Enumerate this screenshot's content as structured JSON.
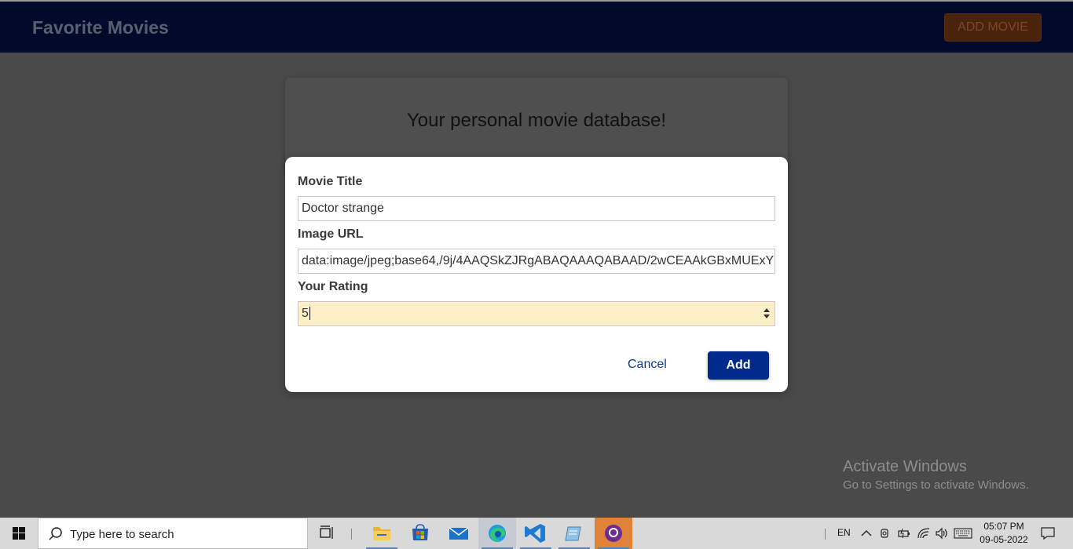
{
  "header": {
    "brand": "Favorite Movies",
    "add_movie_label": "ADD MOVIE"
  },
  "card": {
    "tagline": "Your personal movie database!"
  },
  "modal": {
    "title_label": "Movie Title",
    "title_value": "Doctor strange",
    "image_label": "Image URL",
    "image_value": "data:image/jpeg;base64,/9j/4AAQSkZJRgABAQAAAQABAAD/2wCEAAkGBxMUExY",
    "rating_label": "Your Rating",
    "rating_value": "5",
    "cancel_label": "Cancel",
    "add_label": "Add"
  },
  "watermark": {
    "line1": "Activate Windows",
    "line2": "Go to Settings to activate Windows."
  },
  "taskbar": {
    "search_placeholder": "Type here to search",
    "language": "EN",
    "time": "05:07 PM",
    "date": "09-05-2022",
    "icons": [
      "windows-start-icon",
      "task-view-icon",
      "file-explorer-icon",
      "microsoft-store-icon",
      "mail-icon",
      "edge-browser-icon",
      "vscode-icon",
      "notepad-icon",
      "github-desktop-icon"
    ]
  },
  "colors": {
    "header_bg": "#000b2b",
    "overlay": "#4a4a4a",
    "primary_button": "#002a8c",
    "rating_highlight": "#fdefc6"
  }
}
